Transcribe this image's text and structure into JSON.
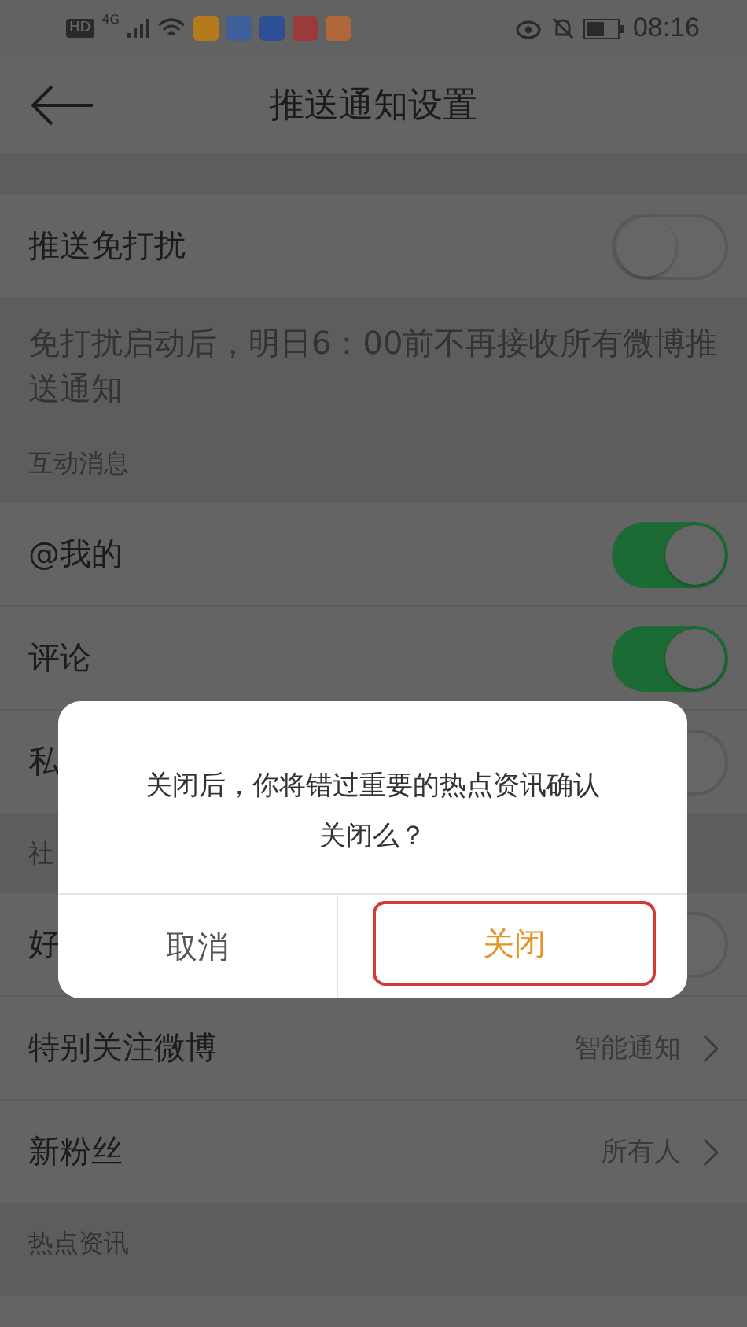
{
  "status_bar": {
    "hd": "HD",
    "network": "4G",
    "time": "08:16"
  },
  "header": {
    "title": "推送通知设置"
  },
  "do_not_disturb": {
    "label": "推送免打扰",
    "on": false
  },
  "description": "免打扰启动后，明日6：00前不再接收所有微博推送通知",
  "sections": [
    {
      "title": "互动消息",
      "rows": [
        {
          "kind": "toggle",
          "label": "@我的",
          "on": true
        },
        {
          "kind": "toggle",
          "label": "评论",
          "on": true
        },
        {
          "kind": "toggle",
          "label": "私",
          "on": false
        }
      ]
    },
    {
      "title": "社",
      "rows": [
        {
          "kind": "toggle",
          "label": "好",
          "on": false
        },
        {
          "kind": "link",
          "label": "特别关注微博",
          "value": "智能通知"
        },
        {
          "kind": "link",
          "label": "新粉丝",
          "value": "所有人"
        }
      ]
    },
    {
      "title": "热点资讯"
    }
  ],
  "dialog": {
    "message": "关闭后，你将错过重要的热点资讯确认关闭么？",
    "buttons": [
      {
        "label": "取消",
        "kind": "cancel",
        "highlighted": false
      },
      {
        "label": "关闭",
        "kind": "confirm",
        "highlighted": true
      }
    ]
  }
}
